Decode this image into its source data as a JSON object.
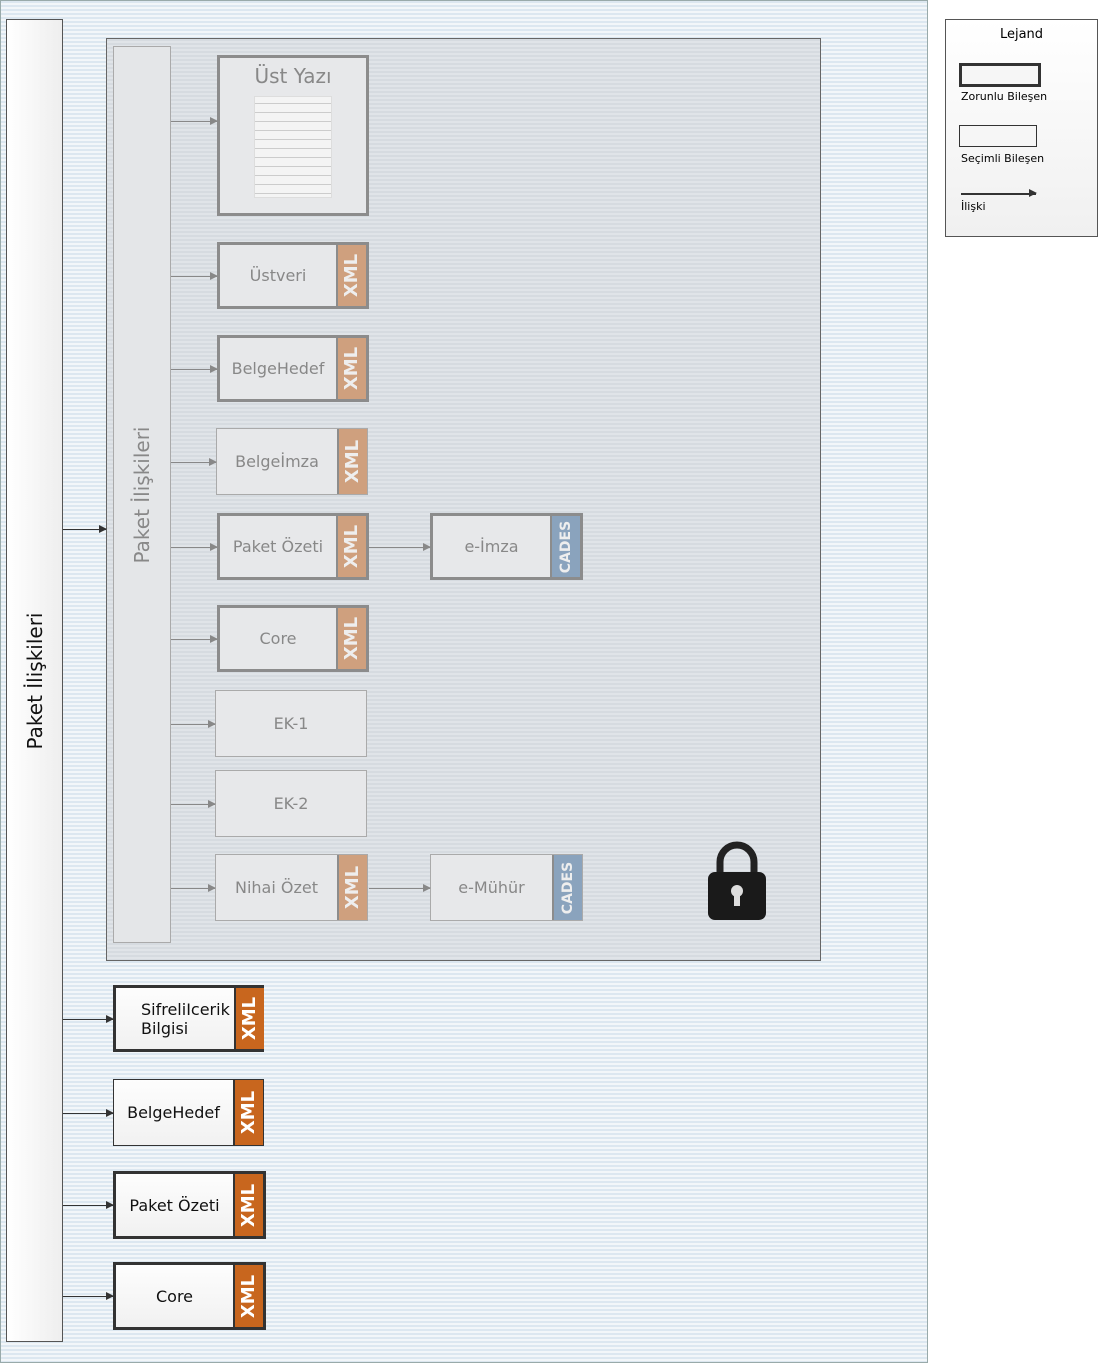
{
  "outer_label": "Paket İlişkileri",
  "inner_label": "Paket İlişkileri",
  "inner_boxes": [
    {
      "label": "Üst Yazı",
      "required": true,
      "tag": ""
    },
    {
      "label": "Üstveri",
      "required": true,
      "tag": "XML"
    },
    {
      "label": "BelgeHedef",
      "required": true,
      "tag": "XML"
    },
    {
      "label": "Belgeİmza",
      "required": false,
      "tag": "XML"
    },
    {
      "label": "Paket Özeti",
      "required": true,
      "tag": "XML"
    },
    {
      "label": "e-İmza",
      "required": true,
      "tag": "CADES"
    },
    {
      "label": "Core",
      "required": true,
      "tag": "XML"
    },
    {
      "label": "EK-1",
      "required": false,
      "tag": ""
    },
    {
      "label": "EK-2",
      "required": false,
      "tag": ""
    },
    {
      "label": "Nihai Özet",
      "required": false,
      "tag": "XML"
    },
    {
      "label": "e-Mühür",
      "required": false,
      "tag": "CADES"
    }
  ],
  "outer_boxes": [
    {
      "label": "SifreliIcerik Bilgisi",
      "required": true,
      "tag": "XML"
    },
    {
      "label": "BelgeHedef",
      "required": false,
      "tag": "XML"
    },
    {
      "label": "Paket Özeti",
      "required": true,
      "tag": "XML"
    },
    {
      "label": "Core",
      "required": true,
      "tag": "XML"
    }
  ],
  "lock_icon": "padlock-icon",
  "legend": {
    "title": "Lejand",
    "required": "Zorunlu Bileşen",
    "optional": "Seçimli Bileşen",
    "relation": "İlişki"
  },
  "colors": {
    "xml": "#c8661e",
    "cades": "#8aa3bd"
  }
}
